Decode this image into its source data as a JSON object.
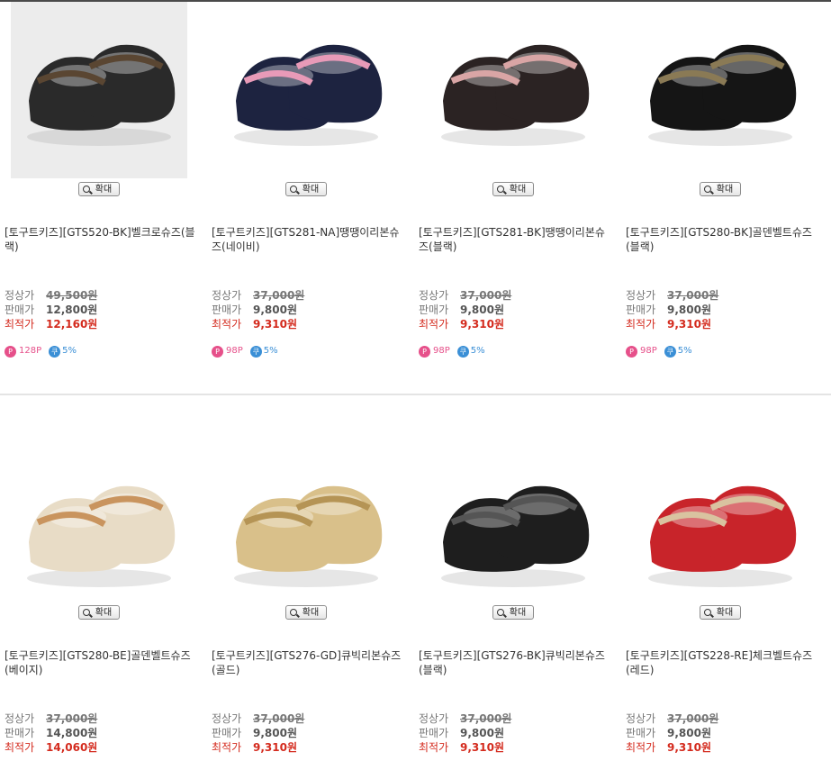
{
  "zoom_label": "확대",
  "price_labels": {
    "regular": "정상가",
    "sale": "판매가",
    "lowest": "최적가"
  },
  "products": [
    {
      "title": "[토구트키즈][GTS520-BK]벨크로슈즈(블랙)",
      "regular": "49,500원",
      "sale": "12,800원",
      "lowest": "12,160원",
      "points": "128P",
      "coupon": "5%",
      "color": "#2a2a2a",
      "accent": "#5a4632"
    },
    {
      "title": "[토구트키즈][GTS281-NA]땡땡이리본슈즈(네이비)",
      "regular": "37,000원",
      "sale": "9,800원",
      "lowest": "9,310원",
      "points": "98P",
      "coupon": "5%",
      "color": "#1d2340",
      "accent": "#e89ab8"
    },
    {
      "title": "[토구트키즈][GTS281-BK]땡땡이리본슈즈(블랙)",
      "regular": "37,000원",
      "sale": "9,800원",
      "lowest": "9,310원",
      "points": "98P",
      "coupon": "5%",
      "color": "#2b2323",
      "accent": "#d9a5a5"
    },
    {
      "title": "[토구트키즈][GTS280-BK]골덴벨트슈즈(블랙)",
      "regular": "37,000원",
      "sale": "9,800원",
      "lowest": "9,310원",
      "points": "98P",
      "coupon": "5%",
      "color": "#151515",
      "accent": "#8a7a55"
    },
    {
      "title": "[토구트키즈][GTS280-BE]골덴벨트슈즈(베이지)",
      "regular": "37,000원",
      "sale": "14,800원",
      "lowest": "14,060원",
      "points": "",
      "coupon": "",
      "color": "#e8dcc6",
      "accent": "#c9945e"
    },
    {
      "title": "[토구트키즈][GTS276-GD]큐빅리본슈즈(골드)",
      "regular": "37,000원",
      "sale": "9,800원",
      "lowest": "9,310원",
      "points": "",
      "coupon": "",
      "color": "#d9c08a",
      "accent": "#b59455"
    },
    {
      "title": "[토구트키즈][GTS276-BK]큐빅리본슈즈(블랙)",
      "regular": "37,000원",
      "sale": "9,800원",
      "lowest": "9,310원",
      "points": "",
      "coupon": "",
      "color": "#1e1e1e",
      "accent": "#555555"
    },
    {
      "title": "[토구트키즈][GTS228-RE]체크벨트슈즈(레드)",
      "regular": "37,000원",
      "sale": "9,800원",
      "lowest": "9,310원",
      "points": "",
      "coupon": "",
      "color": "#c8242a",
      "accent": "#d9c3a0"
    }
  ]
}
